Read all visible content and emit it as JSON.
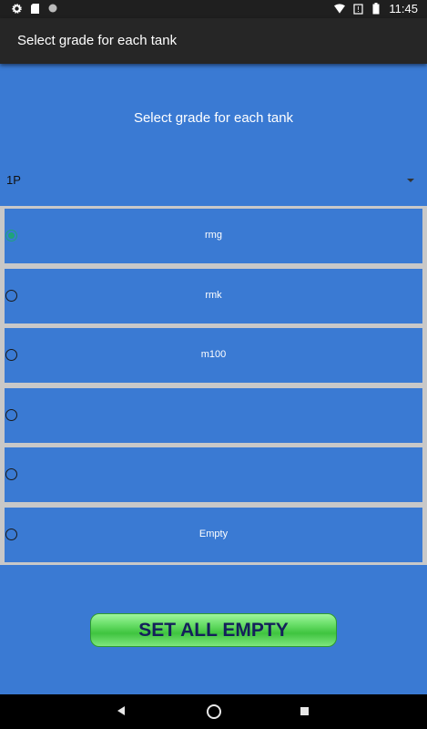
{
  "status_bar": {
    "time": "11:45",
    "left_icons": [
      "gear-icon",
      "sd-card-icon",
      "circle-icon"
    ],
    "right_icons": [
      "wifi-icon",
      "no-sim-icon",
      "battery-icon"
    ]
  },
  "app_bar": {
    "title": "Select grade for each tank"
  },
  "heading": "Select grade for each tank",
  "spinner": {
    "value": "1P"
  },
  "tanks": [
    {
      "label": "rmg",
      "checked": true
    },
    {
      "label": "rmk",
      "checked": false
    },
    {
      "label": "m100",
      "checked": false
    },
    {
      "label": "",
      "checked": false
    },
    {
      "label": "",
      "checked": false
    },
    {
      "label": "Empty",
      "checked": false
    }
  ],
  "button": {
    "label": "SET ALL EMPTY"
  },
  "colors": {
    "background": "#3a7ad3",
    "app_bar": "#262626",
    "radio_checked": "#1fa37a",
    "button_text": "#14205a"
  }
}
